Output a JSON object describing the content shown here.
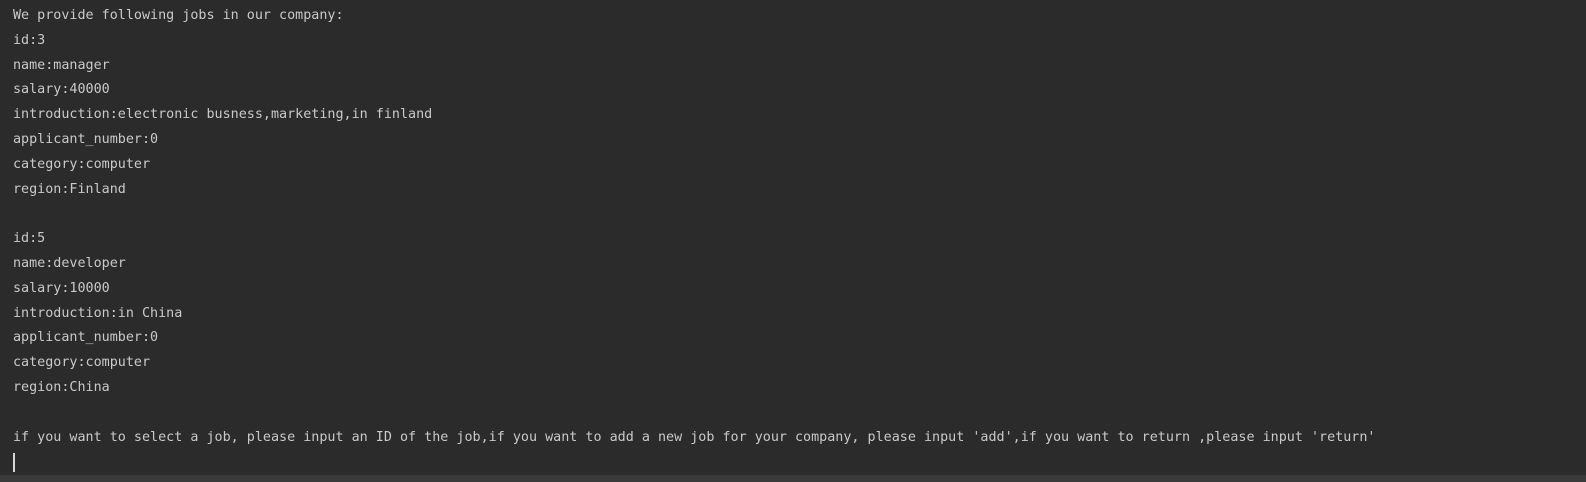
{
  "console": {
    "header": "We provide following jobs in our company:",
    "jobs": [
      {
        "id": "id:3",
        "name": "name:manager",
        "salary": "salary:40000",
        "introduction": "introduction:electronic busness,marketing,in finland",
        "applicant_number": "applicant_number:0",
        "category": "category:computer",
        "region": "region:Finland"
      },
      {
        "id": "id:5",
        "name": "name:developer",
        "salary": "salary:10000",
        "introduction": "introduction:in China",
        "applicant_number": "applicant_number:0",
        "category": "category:computer",
        "region": "region:China"
      }
    ],
    "prompt": "if you want to select a job, please input an ID of the job,if you want to add a new job for your company, please input 'add',if you want to return ,please input 'return'",
    "input_value": ""
  }
}
